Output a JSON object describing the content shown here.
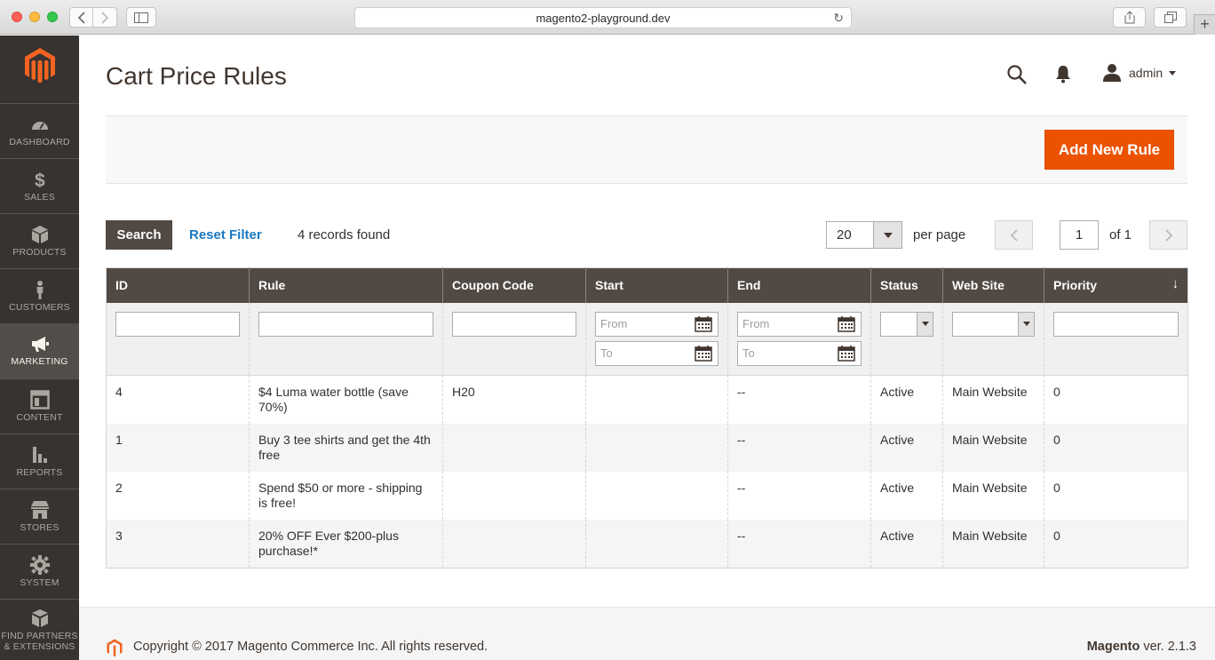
{
  "browser": {
    "url": "magento2-playground.dev",
    "new_tab": "+"
  },
  "sidebar": {
    "items": [
      {
        "label": "DASHBOARD",
        "icon": "dashboard-icon"
      },
      {
        "label": "SALES",
        "icon": "dollar-icon"
      },
      {
        "label": "PRODUCTS",
        "icon": "box-icon"
      },
      {
        "label": "CUSTOMERS",
        "icon": "person-icon"
      },
      {
        "label": "MARKETING",
        "icon": "megaphone-icon",
        "active": true
      },
      {
        "label": "CONTENT",
        "icon": "layout-icon"
      },
      {
        "label": "REPORTS",
        "icon": "bar-chart-icon"
      },
      {
        "label": "STORES",
        "icon": "store-icon"
      },
      {
        "label": "SYSTEM",
        "icon": "gear-icon"
      },
      {
        "label_line1": "FIND PARTNERS",
        "label_line2": "& EXTENSIONS",
        "icon": "blocks-icon"
      }
    ]
  },
  "header": {
    "title": "Cart Price Rules",
    "user": "admin"
  },
  "actions": {
    "add_new_rule": "Add New Rule"
  },
  "toolbar": {
    "search": "Search",
    "reset_filter": "Reset Filter",
    "records": "4 records found",
    "per_page_value": "20",
    "per_page_label": "per page",
    "page": "1",
    "of_pages": "of 1"
  },
  "grid": {
    "columns": [
      "ID",
      "Rule",
      "Coupon Code",
      "Start",
      "End",
      "Status",
      "Web Site",
      "Priority"
    ],
    "sort_indicator": "↓",
    "filters": {
      "from_placeholder": "From",
      "to_placeholder": "To"
    },
    "rows": [
      {
        "id": "4",
        "rule": "$4 Luma water bottle (save 70%)",
        "coupon": "H20",
        "start": "",
        "end": "--",
        "status": "Active",
        "website": "Main Website",
        "priority": "0"
      },
      {
        "id": "1",
        "rule": "Buy 3 tee shirts and get the 4th free",
        "coupon": "",
        "start": "",
        "end": "--",
        "status": "Active",
        "website": "Main Website",
        "priority": "0"
      },
      {
        "id": "2",
        "rule": "Spend $50 or more - shipping is free!",
        "coupon": "",
        "start": "",
        "end": "--",
        "status": "Active",
        "website": "Main Website",
        "priority": "0"
      },
      {
        "id": "3",
        "rule": "20% OFF Ever $200-plus purchase!*",
        "coupon": "",
        "start": "",
        "end": "--",
        "status": "Active",
        "website": "Main Website",
        "priority": "0"
      }
    ]
  },
  "footer": {
    "copyright": "Copyright © 2017 Magento Commerce Inc. All rights reserved.",
    "brand": "Magento",
    "version": " ver. 2.1.3"
  },
  "colors": {
    "sidebar_bg": "#373330",
    "accent": "#eb5202",
    "header_bg": "#514943",
    "link": "#1979c3"
  }
}
